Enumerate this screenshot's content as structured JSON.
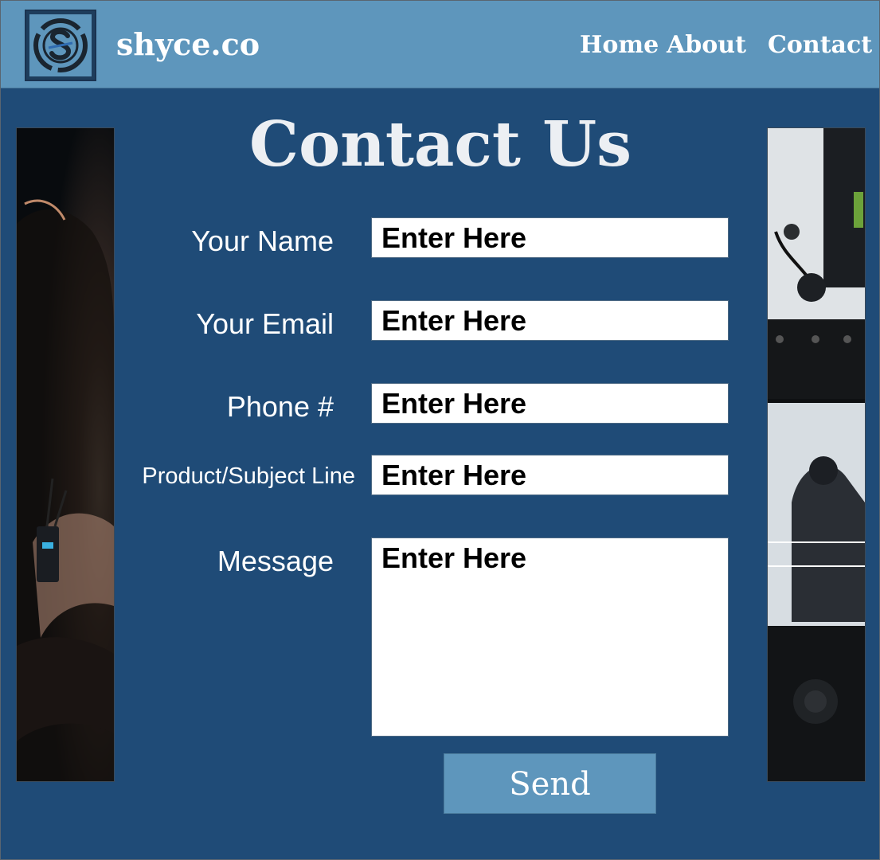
{
  "header": {
    "brand": "shyce.co",
    "logo_icon": "shyce-s-logo-icon",
    "nav": [
      "Home",
      "About",
      "Contact"
    ]
  },
  "page": {
    "title": "Contact Us"
  },
  "form": {
    "fields": [
      {
        "label": "Your Name",
        "value": "Enter Here"
      },
      {
        "label": "Your Email",
        "value": "Enter Here"
      },
      {
        "label": "Phone #",
        "value": "Enter Here"
      },
      {
        "label": "Product/Subject Line",
        "value": "Enter Here"
      },
      {
        "label": "Message",
        "value": "Enter Here"
      }
    ],
    "submit_label": "Send"
  },
  "colors": {
    "background": "#1f4b77",
    "header": "#5e96bc",
    "button": "#5e96bc"
  }
}
